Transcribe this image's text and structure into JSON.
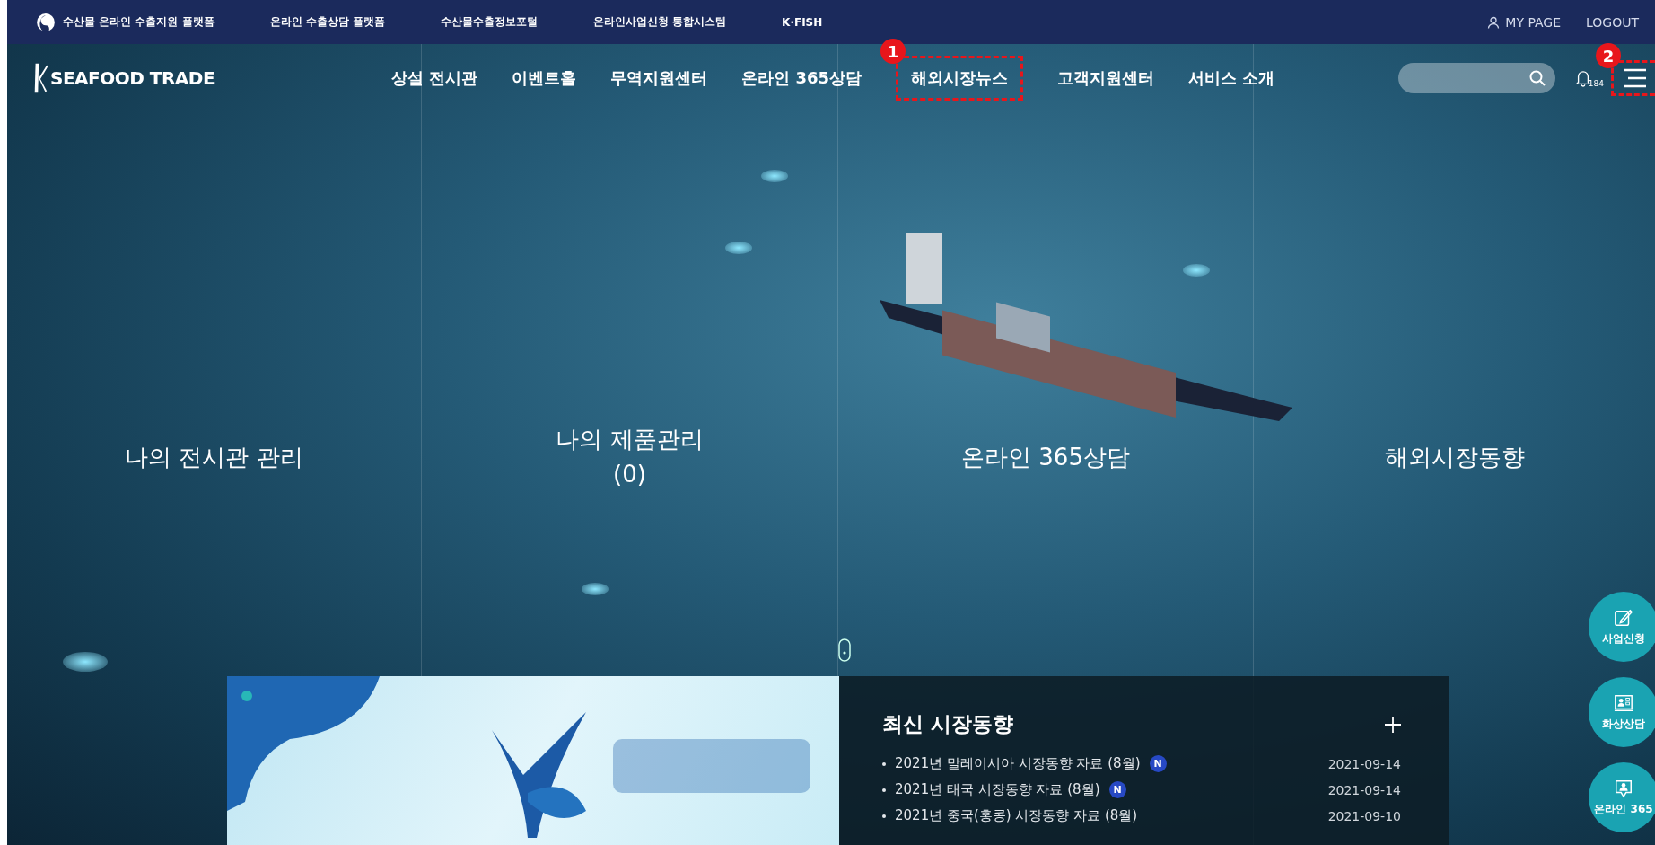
{
  "top_bar": {
    "links": [
      "수산물 온라인 수출지원 플랫폼",
      "온라인 수출상담 플랫폼",
      "수산물수출정보포털",
      "온라인사업신청 통합시스템",
      "K·FISH"
    ],
    "user_links": [
      "MY PAGE",
      "LOGOUT"
    ]
  },
  "header": {
    "logo": "SEAFOOD TRADE",
    "nav": [
      {
        "label": "상설 전시관"
      },
      {
        "label": "이벤트홀"
      },
      {
        "label": "무역지원센터"
      },
      {
        "label": "온라인 365상담"
      },
      {
        "label": "해외시장뉴스",
        "annotation": "1"
      },
      {
        "label": "고객지원센터"
      },
      {
        "label": "서비스 소개"
      }
    ],
    "notification_count": "184",
    "menu_annotation": "2"
  },
  "hero": {
    "columns": [
      {
        "lines": [
          "나의 전시관 관리"
        ]
      },
      {
        "lines": [
          "나의 제품관리",
          "(0)"
        ]
      },
      {
        "lines": [
          "온라인 365상담"
        ]
      },
      {
        "lines": [
          "해외시장동향"
        ]
      }
    ]
  },
  "news": {
    "title": "최신 시장동향",
    "items": [
      {
        "title": "2021년 말레이시아 시장동향 자료 (8월)",
        "new": true,
        "new_badge": "N",
        "date": "2021-09-14"
      },
      {
        "title": "2021년 태국 시장동향 자료 (8월)",
        "new": true,
        "new_badge": "N",
        "date": "2021-09-14"
      },
      {
        "title": "2021년 중국(홍콩) 시장동향 자료 (8월)",
        "new": false,
        "date": "2021-09-10"
      }
    ]
  },
  "quick_buttons": [
    {
      "label": "사업신청",
      "kind": "apply"
    },
    {
      "label": "화상상담",
      "kind": "video"
    },
    {
      "label": "온라인 365",
      "kind": "chat"
    }
  ]
}
